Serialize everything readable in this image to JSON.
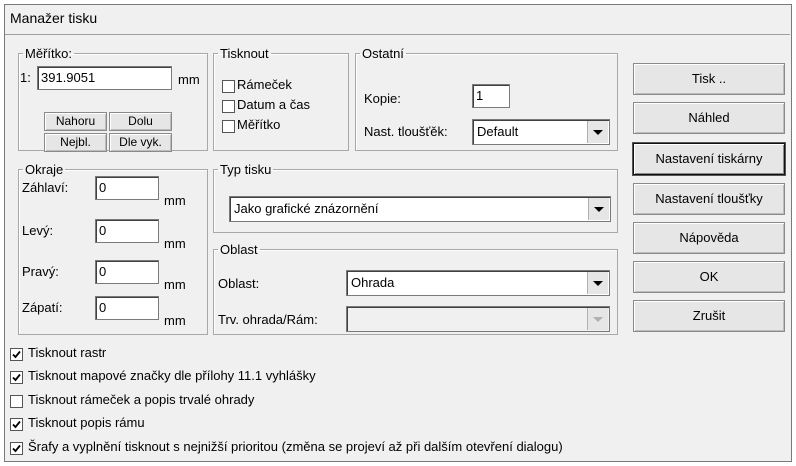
{
  "window": {
    "title": "Manažer tisku"
  },
  "scale": {
    "legend": "Měřítko:",
    "prefix": "1:",
    "value": "391.9051",
    "unit": "mm",
    "btn_up": "Nahoru",
    "btn_down": "Dolu",
    "btn_nearest": "Nejbl.",
    "btn_by_drawing": "Dle vyk."
  },
  "print_options": {
    "legend": "Tisknout",
    "items": [
      {
        "label": "Rámeček",
        "checked": false
      },
      {
        "label": "Datum a čas",
        "checked": false
      },
      {
        "label": "Měřítko",
        "checked": false
      }
    ]
  },
  "other": {
    "legend": "Ostatní",
    "copies_label": "Kopie:",
    "copies_value": "1",
    "thickness_label": "Nast. tloušťěk:",
    "thickness_value": "Default"
  },
  "margins": {
    "legend": "Okraje",
    "unit": "mm",
    "rows": [
      {
        "label": "Záhlaví:",
        "value": "0"
      },
      {
        "label": "Levý:",
        "value": "0"
      },
      {
        "label": "Pravý:",
        "value": "0"
      },
      {
        "label": "Zápatí:",
        "value": "0"
      }
    ]
  },
  "print_type": {
    "legend": "Typ tisku",
    "value": "Jako grafické znázornění"
  },
  "area": {
    "legend": "Oblast",
    "area_label": "Oblast:",
    "area_value": "Ohrada",
    "fence_label": "Trv. ohrada/Rám:",
    "fence_value": ""
  },
  "buttons": {
    "print": "Tisk ..",
    "preview": "Náhled",
    "printer_settings": "Nastavení tiskárny",
    "thickness_settings": "Nastavení tloušťky",
    "help": "Nápověda",
    "ok": "OK",
    "cancel": "Zrušit"
  },
  "bottom_options": [
    {
      "label": "Tisknout rastr",
      "checked": true
    },
    {
      "label": "Tisknout mapové značky dle přílohy 11.1 vyhlášky",
      "checked": true
    },
    {
      "label": "Tisknout rámeček a popis trvalé ohrady",
      "checked": false
    },
    {
      "label": "Tisknout popis rámu",
      "checked": true
    },
    {
      "label": "Šrafy a vyplnění tisknout s nejnižší prioritou (změna se projeví až při dalším otevření dialogu)",
      "checked": true
    }
  ]
}
